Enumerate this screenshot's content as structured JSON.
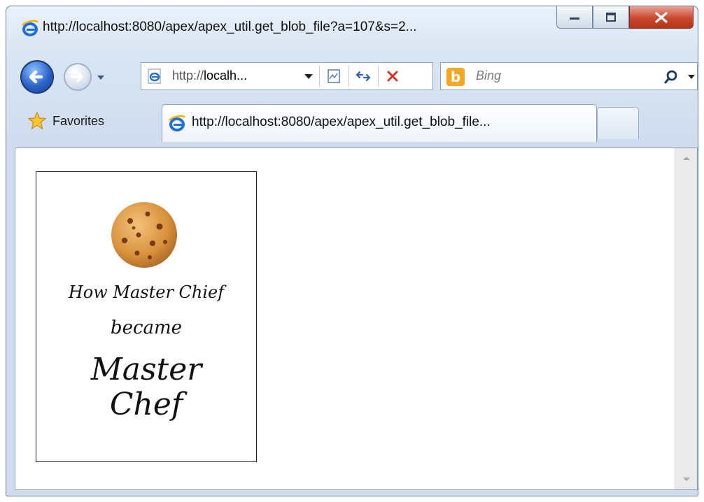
{
  "window": {
    "title": "http://localhost:8080/apex/apex_util.get_blob_file?a=107&s=2..."
  },
  "navbar": {
    "address": "http://localh...",
    "address_prefix": "http://",
    "address_host": "localh...",
    "search_placeholder": "Bing"
  },
  "tabs": {
    "favorites_label": "Favorites",
    "active_tab_title": "http://localhost:8080/apex/apex_util.get_blob_file..."
  },
  "content": {
    "image_line1": "How Master Chief",
    "image_line2": "became",
    "image_line3a": "Master",
    "image_line3b": "Chef"
  },
  "colors": {
    "close_button": "#c9482f",
    "bing": "#f5a623",
    "ie_blue": "#1e6fd9"
  },
  "icons": [
    "ie-logo-icon",
    "minimize-icon",
    "maximize-icon",
    "close-icon",
    "back-arrow-icon",
    "forward-arrow-icon",
    "dropdown-icon",
    "compatibility-view-icon",
    "refresh-icon",
    "stop-icon",
    "bing-icon",
    "search-icon",
    "favorites-star-icon",
    "scroll-up-icon",
    "scroll-down-icon",
    "cookie-icon"
  ]
}
